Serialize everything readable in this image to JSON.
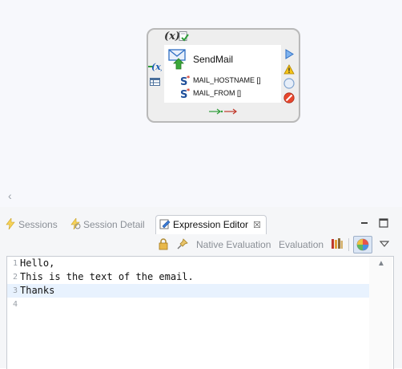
{
  "diagram": {
    "node": {
      "title": "SendMail",
      "properties": [
        "MAIL_HOSTNAME []",
        "MAIL_FROM []"
      ],
      "icons": {
        "variable": "variable-icon",
        "check": "document-check-icon",
        "mail": "send-mail-icon",
        "input": "input-variable-icon",
        "table": "table-icon",
        "property": "string-property-icon",
        "play": "play-icon",
        "warning": "warning-icon",
        "breakpoint": "breakpoint-circle-icon",
        "stop": "stop-icon",
        "flow": "flow-arrows-icon"
      },
      "variable_glyph": "(x)"
    }
  },
  "panel": {
    "tabs": [
      {
        "label": "Sessions",
        "icon": "lightning-icon",
        "active": false
      },
      {
        "label": "Session Detail",
        "icon": "lightning-detail-icon",
        "active": false
      },
      {
        "label": "Expression Editor",
        "icon": "expression-editor-icon",
        "active": true,
        "close": "☒"
      }
    ],
    "toolbar": {
      "native_evaluation": "Native Evaluation",
      "evaluation": "Evaluation"
    },
    "editor": {
      "lines": [
        {
          "num": "1",
          "text": "Hello,"
        },
        {
          "num": "2",
          "text": "This is the text of the email."
        },
        {
          "num": "3",
          "text": "Thanks"
        },
        {
          "num": "4",
          "text": ""
        }
      ],
      "current_line": 3
    }
  },
  "colors": {
    "accent": "#2f7dd1",
    "warning": "#f0b400",
    "stop": "#e0402a",
    "current_line": "#e8f2fe"
  }
}
